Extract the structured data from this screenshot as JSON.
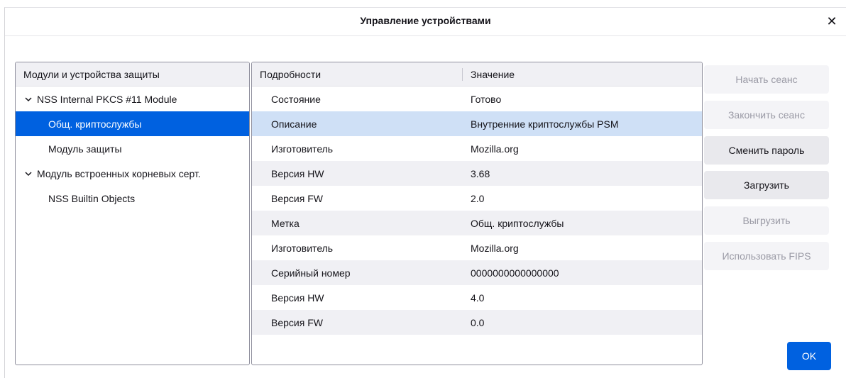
{
  "dialog": {
    "title": "Управление устройствами",
    "close_glyph": "✕"
  },
  "tree": {
    "header": "Модули и устройства защиты",
    "rows": [
      {
        "label": "NSS Internal PKCS #11 Module",
        "level": 0,
        "expanded": true,
        "selected": false
      },
      {
        "label": "Общ. криптослужбы",
        "level": 1,
        "selected": true
      },
      {
        "label": "Модуль защиты",
        "level": 1,
        "selected": false
      },
      {
        "label": "Модуль встроенных корневых серт.",
        "level": 0,
        "expanded": true,
        "selected": false
      },
      {
        "label": "NSS Builtin Objects",
        "level": 1,
        "selected": false
      }
    ]
  },
  "details": {
    "header_details": "Подробности",
    "header_value": "Значение",
    "rows": [
      {
        "key": "Состояние",
        "value": "Готово"
      },
      {
        "key": "Описание",
        "value": "Внутренние криптослужбы PSM"
      },
      {
        "key": "Изготовитель",
        "value": "Mozilla.org"
      },
      {
        "key": "Версия HW",
        "value": "3.68"
      },
      {
        "key": "Версия FW",
        "value": "2.0"
      },
      {
        "key": "Метка",
        "value": "Общ. криптослужбы"
      },
      {
        "key": "Изготовитель",
        "value": "Mozilla.org"
      },
      {
        "key": "Серийный номер",
        "value": "0000000000000000"
      },
      {
        "key": "Версия HW",
        "value": "4.0"
      },
      {
        "key": "Версия FW",
        "value": "0.0"
      }
    ],
    "selected_index": 1
  },
  "buttons": {
    "start_session": "Начать сеанс",
    "end_session": "Закончить сеанс",
    "change_password": "Сменить пароль",
    "load": "Загрузить",
    "unload": "Выгрузить",
    "use_fips": "Использовать FIPS",
    "ok": "OK"
  },
  "colors": {
    "accent": "#0061e0",
    "row_selected": "#cfe0f6",
    "row_alt": "#f0f0f4"
  }
}
